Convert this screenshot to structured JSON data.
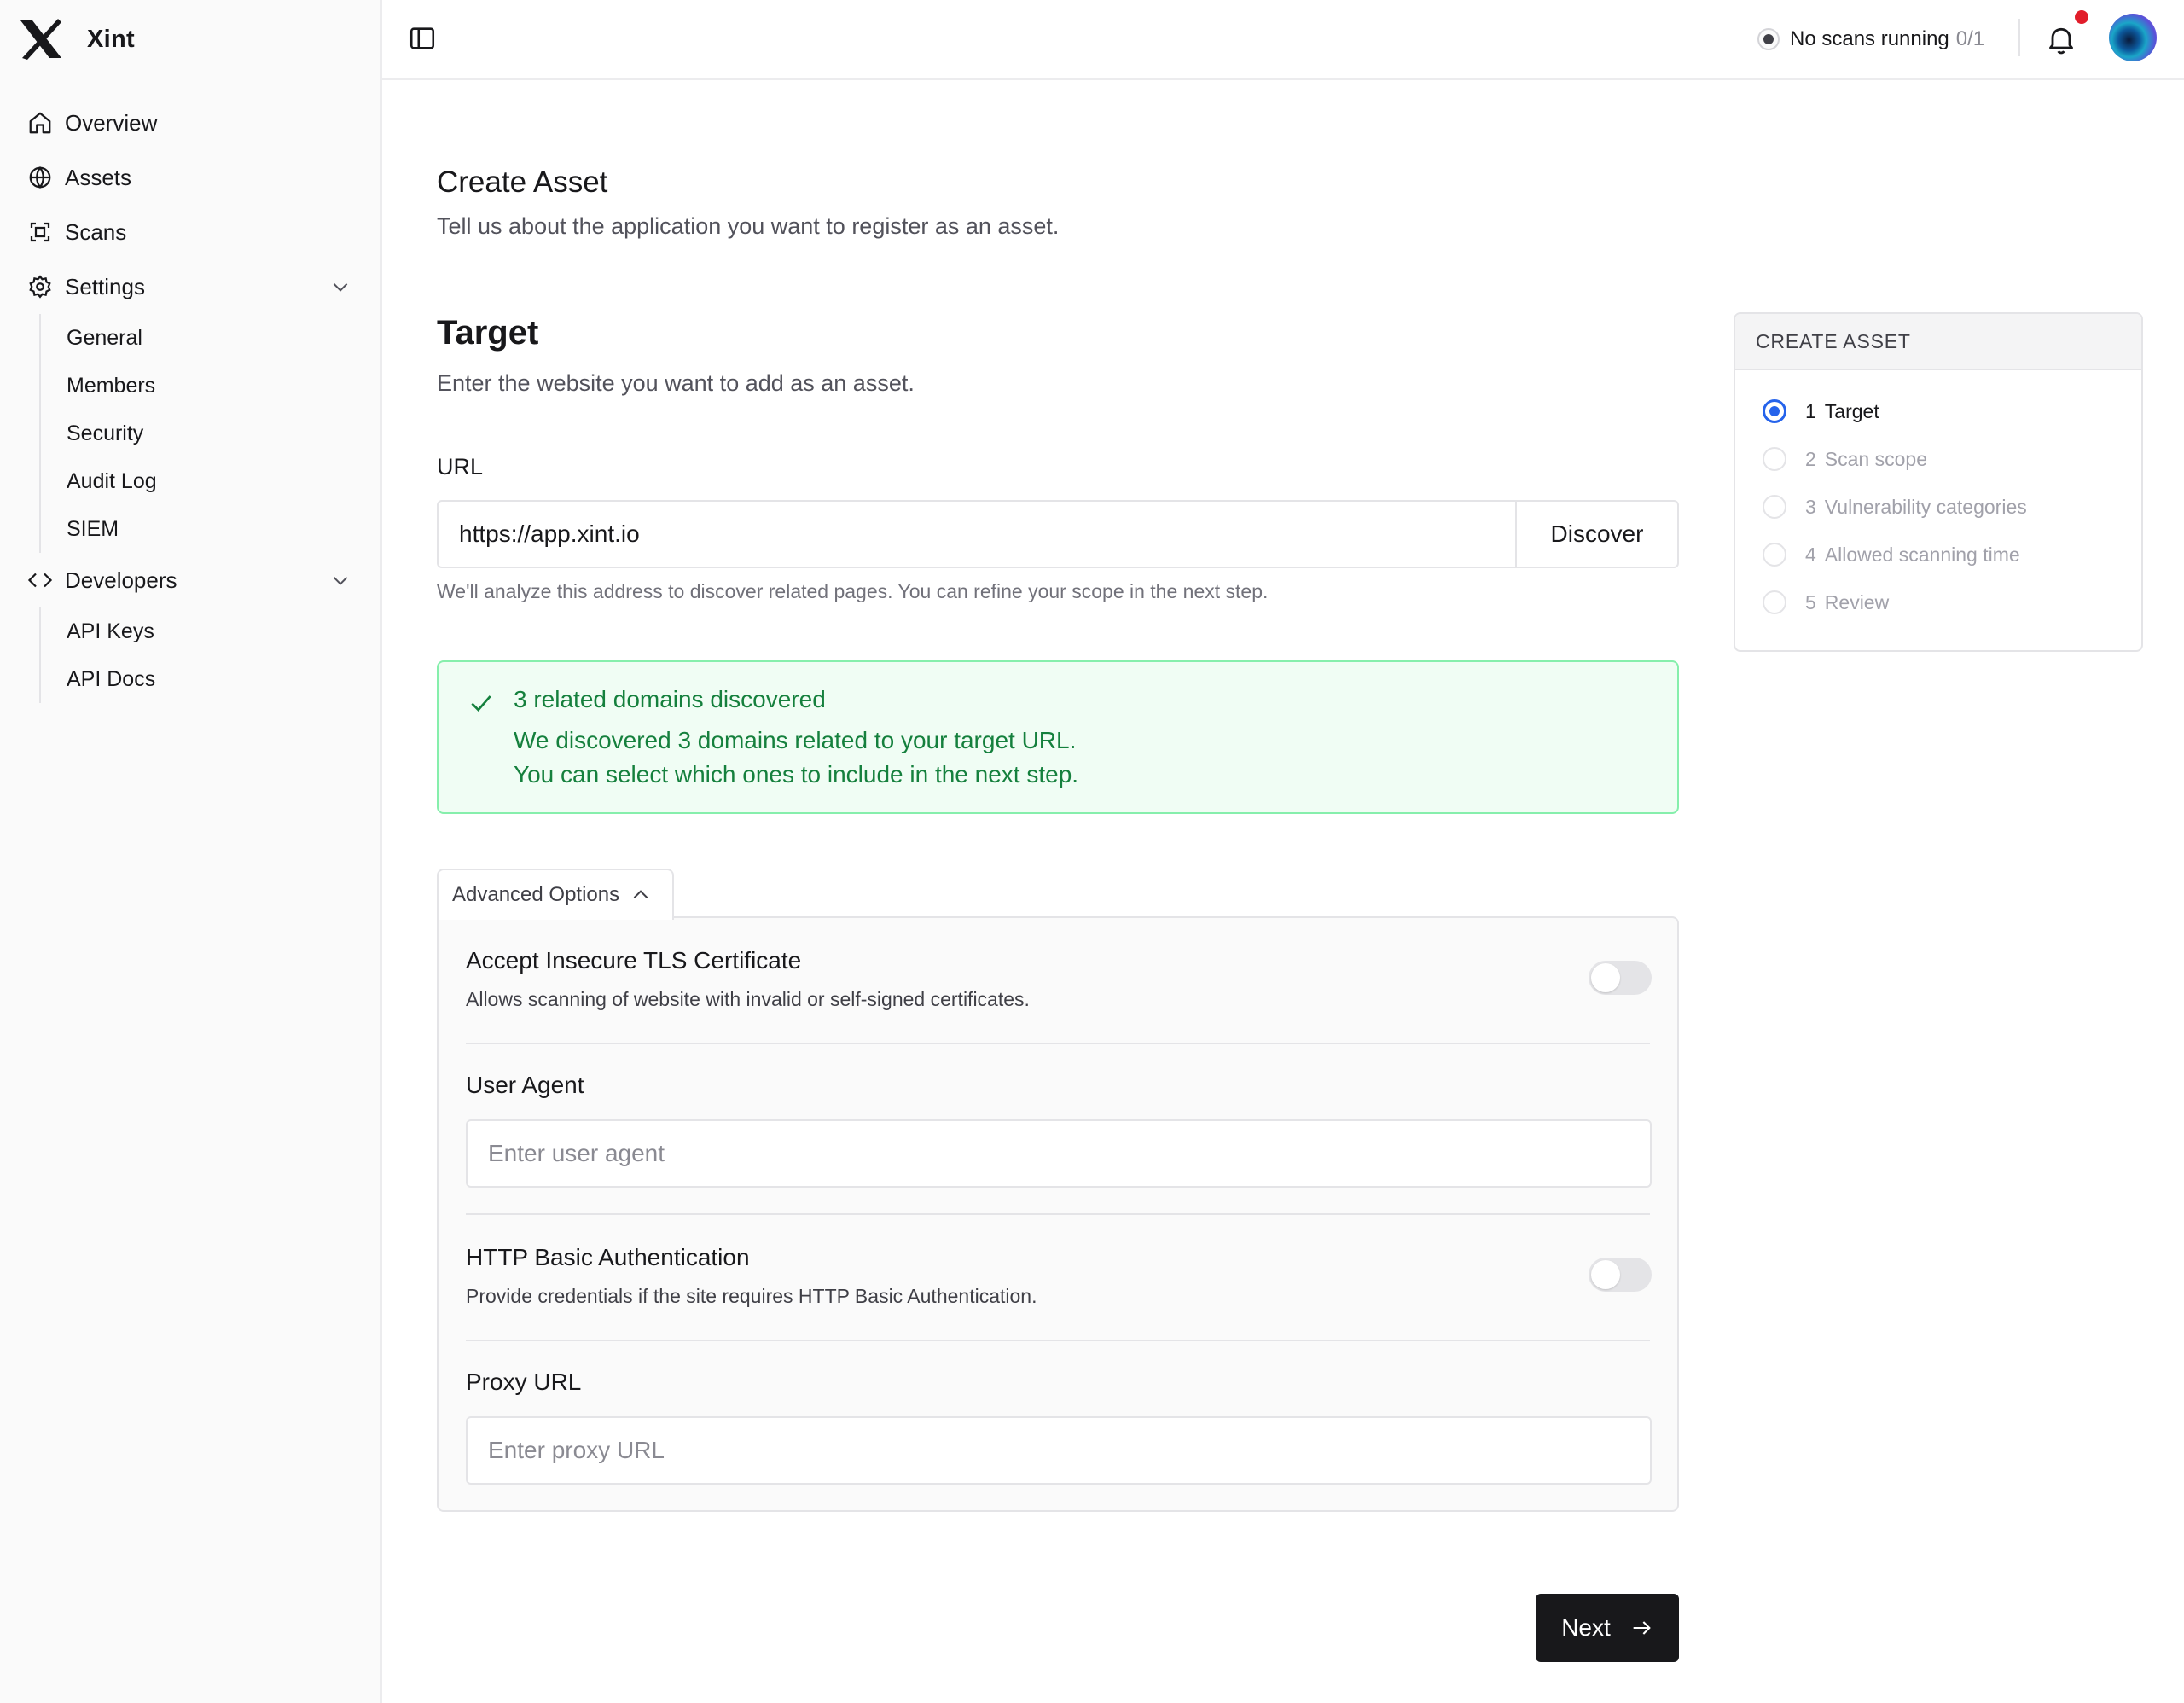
{
  "app": {
    "name": "Xint"
  },
  "sidebar": {
    "items": [
      {
        "label": "Overview",
        "icon": "home-icon"
      },
      {
        "label": "Assets",
        "icon": "globe-icon"
      },
      {
        "label": "Scans",
        "icon": "scan-icon"
      },
      {
        "label": "Settings",
        "icon": "gear-icon",
        "expanded": true,
        "children": [
          {
            "label": "General"
          },
          {
            "label": "Members"
          },
          {
            "label": "Security"
          },
          {
            "label": "Audit Log"
          },
          {
            "label": "SIEM"
          }
        ]
      },
      {
        "label": "Developers",
        "icon": "code-icon",
        "expanded": true,
        "children": [
          {
            "label": "API Keys"
          },
          {
            "label": "API Docs"
          }
        ]
      }
    ]
  },
  "topbar": {
    "scan_status": "No scans running",
    "scan_count": "0/1",
    "notification_dot_color": "#e11d2a"
  },
  "page": {
    "title": "Create Asset",
    "subtitle": "Tell us about the application you want to register as an asset."
  },
  "target": {
    "title": "Target",
    "subtitle": "Enter the website you want to add as an asset.",
    "url_label": "URL",
    "url_value": "https://app.xint.io",
    "discover_label": "Discover",
    "help_text": "We'll analyze this address to discover related pages. You can refine your scope in the next step."
  },
  "alert": {
    "title": "3 related domains discovered",
    "line1": "We discovered 3 domains related to your target URL.",
    "line2": "You can select which ones to include in the next step.",
    "color": "#15803d"
  },
  "advanced": {
    "tab_label": "Advanced Options",
    "tls": {
      "title": "Accept Insecure TLS Certificate",
      "description": "Allows scanning of website with invalid or self-signed certificates.",
      "enabled": false
    },
    "user_agent": {
      "label": "User Agent",
      "placeholder": "Enter user agent",
      "value": ""
    },
    "basic_auth": {
      "title": "HTTP Basic Authentication",
      "description": "Provide credentials if the site requires HTTP Basic Authentication.",
      "enabled": false
    },
    "proxy": {
      "label": "Proxy URL",
      "placeholder": "Enter proxy URL",
      "value": ""
    }
  },
  "next_label": "Next",
  "stepper": {
    "header": "CREATE ASSET",
    "active_color": "#2563eb",
    "steps": [
      {
        "num": "1",
        "label": "Target",
        "active": true
      },
      {
        "num": "2",
        "label": "Scan scope",
        "active": false
      },
      {
        "num": "3",
        "label": "Vulnerability categories",
        "active": false
      },
      {
        "num": "4",
        "label": "Allowed scanning time",
        "active": false
      },
      {
        "num": "5",
        "label": "Review",
        "active": false
      }
    ]
  }
}
